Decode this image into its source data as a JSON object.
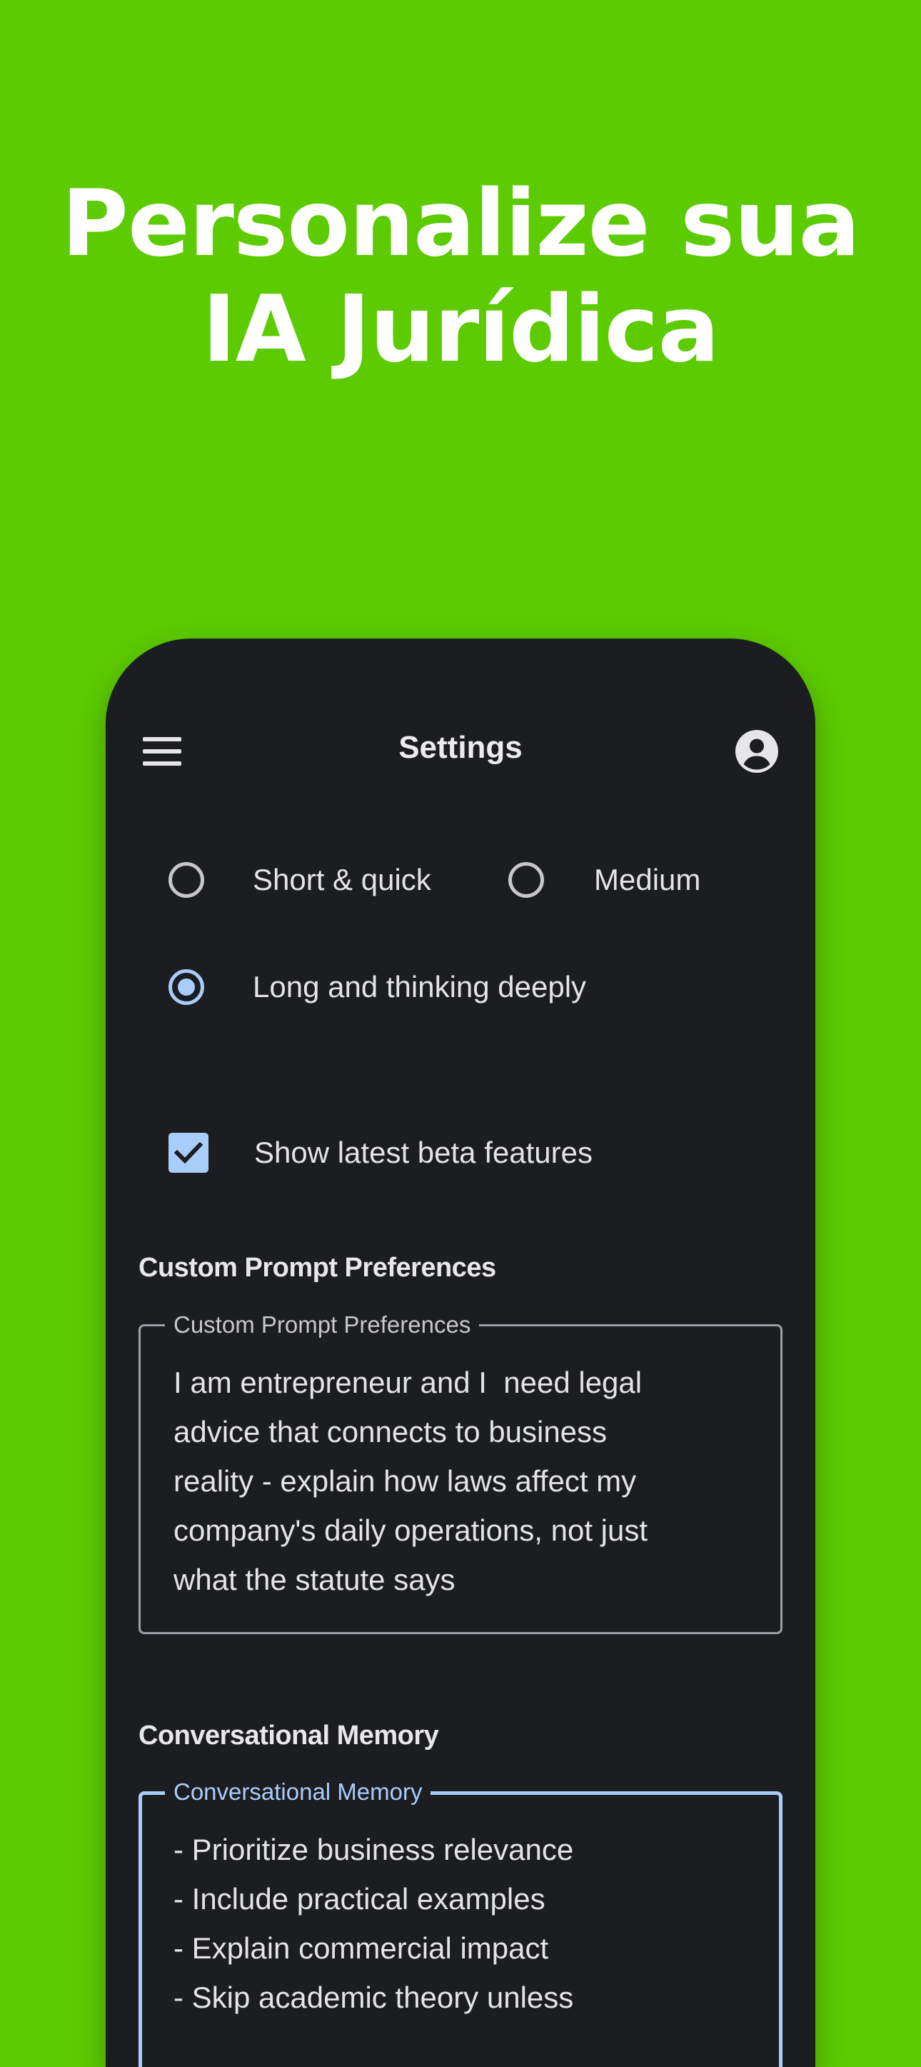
{
  "promo": {
    "headline_line1": "Personalize sua",
    "headline_line2": "IA Jurídica"
  },
  "colors": {
    "background": "#5ccb00",
    "surface": "#1c1d20",
    "accent": "#a9cdfa",
    "text": "#e4e4e6"
  },
  "appbar": {
    "title": "Settings",
    "menu_icon": "hamburger-menu-icon",
    "account_icon": "account-circle-icon"
  },
  "response_length": {
    "options": [
      {
        "label": "Short & quick",
        "selected": false
      },
      {
        "label": "Medium",
        "selected": false
      },
      {
        "label": "Long and thinking deeply",
        "selected": true
      }
    ]
  },
  "beta": {
    "label": "Show latest beta features",
    "checked": true
  },
  "custom_prompt": {
    "heading": "Custom Prompt Preferences",
    "field_label": "Custom Prompt Preferences",
    "value": "I am entrepreneur and I  need legal\nadvice that connects to business\nreality - explain how laws affect my\ncompany's daily operations, not just\nwhat the statute says"
  },
  "memory": {
    "heading": "Conversational Memory",
    "field_label": "Conversational Memory",
    "value": "- Prioritize business relevance\n- Include practical examples\n- Explain commercial impact\n- Skip academic theory unless"
  }
}
